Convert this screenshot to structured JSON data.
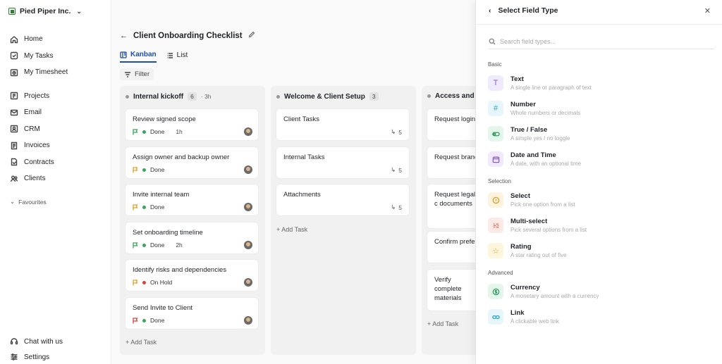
{
  "sidebar": {
    "org_name": "Pied Piper Inc.",
    "items": [
      {
        "label": "Home",
        "icon": "home-icon"
      },
      {
        "label": "My Tasks",
        "icon": "tasks-icon"
      },
      {
        "label": "My Timesheet",
        "icon": "timesheet-icon"
      },
      {
        "label": "Projects",
        "icon": "projects-icon"
      },
      {
        "label": "Email",
        "icon": "email-icon"
      },
      {
        "label": "CRM",
        "icon": "crm-icon"
      },
      {
        "label": "Invoices",
        "icon": "invoices-icon"
      },
      {
        "label": "Contracts",
        "icon": "contracts-icon"
      },
      {
        "label": "Clients",
        "icon": "clients-icon"
      }
    ],
    "favourites_label": "Favourites",
    "bottom": [
      {
        "label": "Chat with us",
        "icon": "headset-icon"
      },
      {
        "label": "Settings",
        "icon": "settings-icon"
      }
    ]
  },
  "main": {
    "title": "Client Onboarding Checklist",
    "views": [
      {
        "label": "Kanban",
        "active": true
      },
      {
        "label": "List",
        "active": false
      }
    ],
    "filter_label": "Filter",
    "add_task_label": "+ Add Task",
    "columns": [
      {
        "name": "Internal kickoff",
        "count": "6",
        "time": "· 3h",
        "cards": [
          {
            "title": "Review signed scope",
            "status": "Done",
            "duration": "1h",
            "flag_color": "#3aa55a",
            "status_color": "#3aa55a"
          },
          {
            "title": "Assign owner and backup owner",
            "status": "Done",
            "duration": "",
            "flag_color": "#e0a030",
            "status_color": "#3aa55a"
          },
          {
            "title": "Invite internal team",
            "status": "Done",
            "duration": "",
            "flag_color": "#e0a030",
            "status_color": "#3aa55a"
          },
          {
            "title": "Set onboarding timeline",
            "status": "Done",
            "duration": "2h",
            "flag_color": "#3aa55a",
            "status_color": "#3aa55a"
          },
          {
            "title": "Identify risks and dependencies",
            "status": "On Hold",
            "duration": "",
            "flag_color": "#e0a030",
            "status_color": "#d6453d"
          },
          {
            "title": "Send Invite to Client",
            "status": "Done",
            "duration": "",
            "flag_color": "#d6453d",
            "status_color": "#3aa55a"
          }
        ]
      },
      {
        "name": "Welcome & Client Setup",
        "count": "3",
        "time": "",
        "cards": [
          {
            "title": "Client Tasks",
            "subtasks": "5"
          },
          {
            "title": "Internal Tasks",
            "subtasks": "5"
          },
          {
            "title": "Attachments",
            "subtasks": "5"
          }
        ]
      },
      {
        "name": "Access and a",
        "count": "",
        "time": "",
        "cards": [
          {
            "title": "Request logins"
          },
          {
            "title": "Request brand"
          },
          {
            "title": "Request legal c documents"
          },
          {
            "title": "Confirm prefer"
          },
          {
            "title": "Verify complete materials"
          }
        ]
      }
    ]
  },
  "panel": {
    "title": "Select Field Type",
    "search_placeholder": "Search field types...",
    "sections": {
      "basic": "Basic",
      "selection": "Selection",
      "advanced": "Advanced"
    },
    "fields": [
      {
        "title": "Text",
        "desc": "A single line or paragraph of text",
        "icon": "text-icon",
        "bg": "#efeafc",
        "fg": "#7b61d9"
      },
      {
        "title": "Number",
        "desc": "Whole numbers or decimals",
        "icon": "hash-icon",
        "bg": "#e6f6fb",
        "fg": "#2aa6c9"
      },
      {
        "title": "True / False",
        "desc": "A simple yes / no toggle",
        "icon": "toggle-icon",
        "bg": "#e5f6ec",
        "fg": "#2e9e5b"
      },
      {
        "title": "Date and Time",
        "desc": "A date, with an optional time",
        "icon": "calendar-icon",
        "bg": "#f1eafc",
        "fg": "#8a5ad6"
      },
      {
        "title": "Select",
        "desc": "Pick one option from a list",
        "icon": "select-icon",
        "bg": "#fdf3df",
        "fg": "#d99a1e"
      },
      {
        "title": "Multi-select",
        "desc": "Pick several options from a list",
        "icon": "multiselect-icon",
        "bg": "#fdeae6",
        "fg": "#e0684f"
      },
      {
        "title": "Rating",
        "desc": "A star rating out of five",
        "icon": "star-icon",
        "bg": "#fdf6dc",
        "fg": "#d4a514"
      },
      {
        "title": "Currency",
        "desc": "A monetary amount with a currency",
        "icon": "dollar-icon",
        "bg": "#e5f6ec",
        "fg": "#2e9e5b"
      },
      {
        "title": "Link",
        "desc": "A clickable web link",
        "icon": "link-icon",
        "bg": "#e6f6fb",
        "fg": "#2aa6c9"
      }
    ]
  }
}
